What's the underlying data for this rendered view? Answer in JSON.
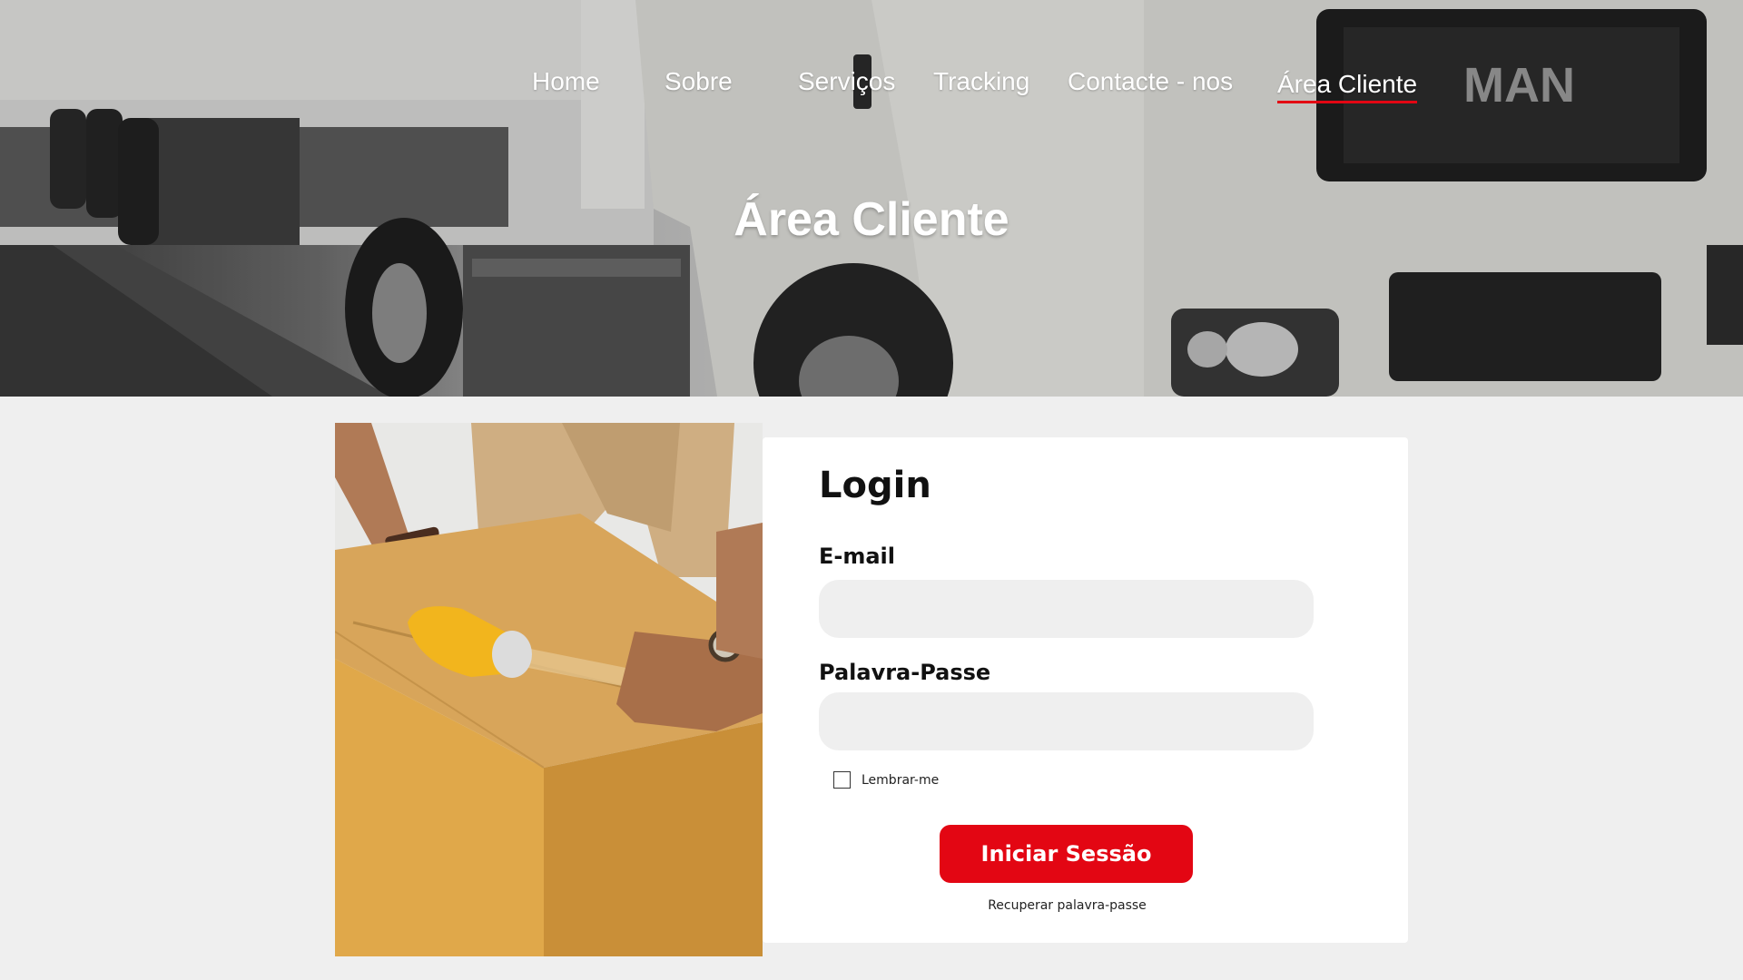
{
  "nav": {
    "items": [
      {
        "label": "Home"
      },
      {
        "label": "Sobre"
      },
      {
        "label": "Serviços"
      },
      {
        "label": "Tracking"
      },
      {
        "label": "Contacte - nos"
      },
      {
        "label": "Área Cliente"
      }
    ],
    "active_label": "Área Cliente"
  },
  "hero": {
    "title": "Área Cliente",
    "truck_brand": "MAN"
  },
  "login": {
    "title": "Login",
    "email_label": "E-mail",
    "email_value": "",
    "password_label": "Palavra-Passe",
    "password_value": "",
    "remember_label": "Lembrar-me",
    "remember_checked": false,
    "submit_label": "Iniciar Sessão",
    "recover_label": "Recuperar palavra-passe"
  },
  "colors": {
    "accent": "#e30613",
    "background": "#efefef",
    "card": "#ffffff",
    "input_bg": "#efefef"
  },
  "icons": {
    "checkbox": "checkbox-unchecked-icon"
  }
}
